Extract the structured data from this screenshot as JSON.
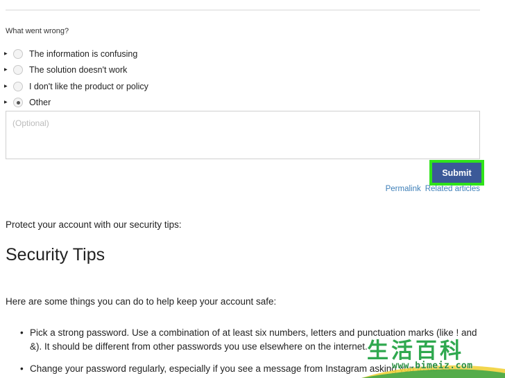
{
  "feedback": {
    "question": "What went wrong?",
    "options": [
      {
        "label": "The information is confusing",
        "selected": false
      },
      {
        "label": "The solution doesn't work",
        "selected": false
      },
      {
        "label": "I don't like the product or policy",
        "selected": false
      },
      {
        "label": "Other",
        "selected": true
      }
    ],
    "comment_placeholder": "(Optional)",
    "comment_value": "",
    "submit_label": "Submit",
    "highlight_color": "#2fe31a",
    "button_color": "#3b5998"
  },
  "links": {
    "permalink": "Permalink",
    "related": "Related articles",
    "color": "#3e7fb8"
  },
  "article": {
    "intro": "Protect your account with our security tips:",
    "heading": "Security Tips",
    "lead": "Here are some things you can do to help keep your account safe:",
    "tips": [
      "Pick a strong password. Use a combination of at least six numbers, letters and punctuation marks (like ! and &). It should be different from other passwords you use elsewhere on the internet.",
      "Change your password regularly, especially if you see a message from Instagram asking you to do so."
    ]
  },
  "watermark": {
    "chars": [
      "生",
      "活",
      "百",
      "科"
    ],
    "url": "www.bimeiz.com",
    "color": "#2fa84f"
  }
}
